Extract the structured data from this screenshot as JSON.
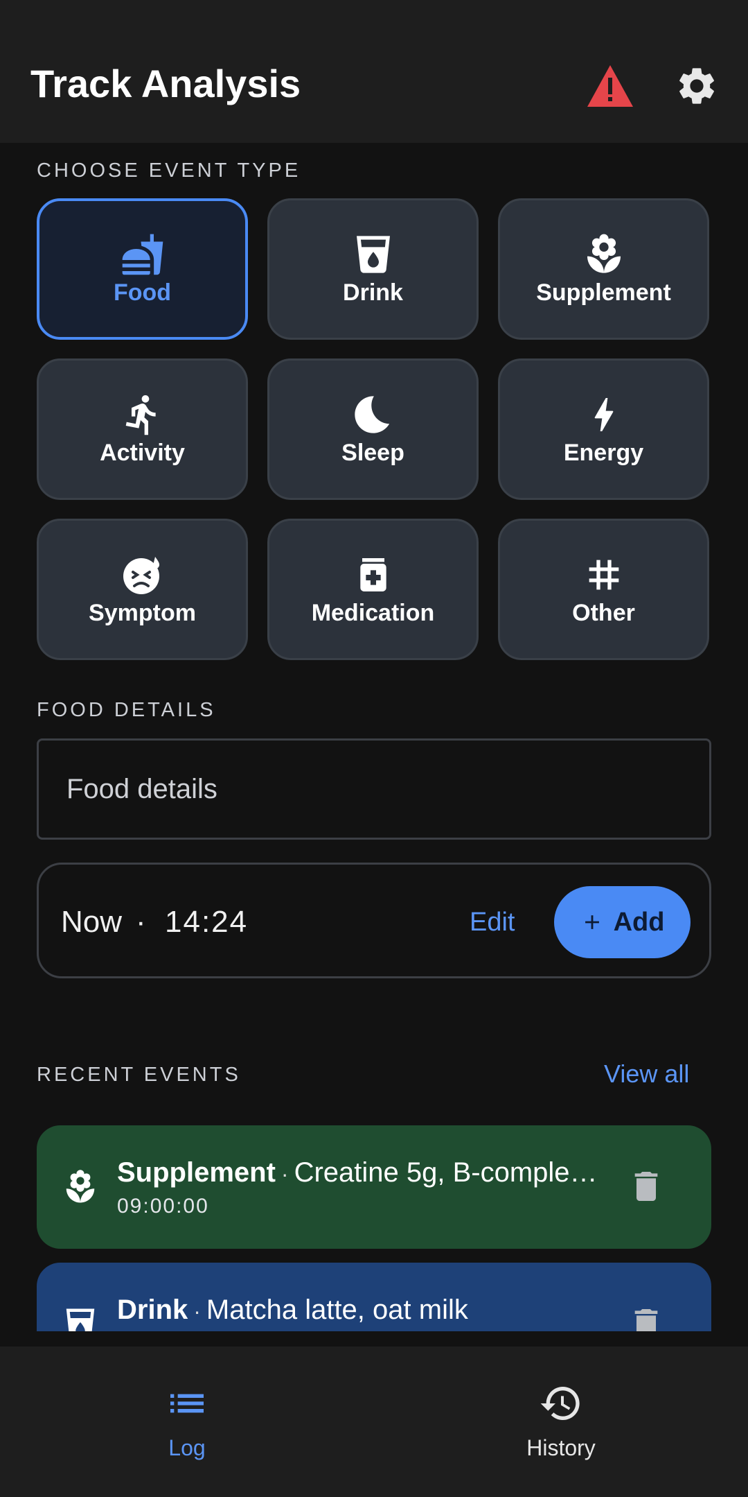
{
  "app_bar": {
    "title": "Track Analysis",
    "warning_icon": "warning-triangle-icon",
    "settings_icon": "gear-icon",
    "warning_color": "#e5454a"
  },
  "event_type": {
    "section_label": "CHOOSE EVENT TYPE",
    "selected": "Food",
    "tiles": [
      {
        "label": "Food",
        "icon": "fastfood-icon"
      },
      {
        "label": "Drink",
        "icon": "cup-icon"
      },
      {
        "label": "Supplement",
        "icon": "leaf-icon"
      },
      {
        "label": "Activity",
        "icon": "running-icon"
      },
      {
        "label": "Sleep",
        "icon": "moon-icon"
      },
      {
        "label": "Energy",
        "icon": "bolt-icon"
      },
      {
        "label": "Symptom",
        "icon": "sick-face-icon"
      },
      {
        "label": "Medication",
        "icon": "medication-icon"
      },
      {
        "label": "Other",
        "icon": "hashtag-icon"
      }
    ]
  },
  "details": {
    "section_label": "FOOD DETAILS",
    "placeholder": "Food details",
    "value": ""
  },
  "time": {
    "label": "Now",
    "separator": "·",
    "value": "14:24",
    "edit_label": "Edit",
    "add_label": "Add"
  },
  "recent": {
    "section_label": "RECENT EVENTS",
    "view_all_label": "View all",
    "events": [
      {
        "type": "Supplement",
        "separator": "·",
        "description": "Creatine 5g, B-comple…",
        "time": "09:00:00",
        "icon": "leaf-icon",
        "color": "#1f4d30"
      },
      {
        "type": "Drink",
        "separator": "·",
        "description": "Matcha latte, oat milk",
        "time": "",
        "icon": "cup-icon",
        "color": "#1e4178"
      }
    ]
  },
  "bottom_nav": {
    "items": [
      {
        "label": "Log",
        "icon": "list-icon",
        "active": true
      },
      {
        "label": "History",
        "icon": "history-icon",
        "active": false
      }
    ],
    "accent": "#5b95f5"
  }
}
